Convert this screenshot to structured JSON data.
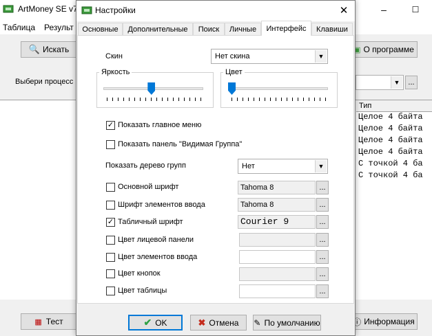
{
  "main_window": {
    "title": "ArtMoney SE v7",
    "menu": [
      "Таблица",
      "Результ"
    ],
    "search_button": "Искать",
    "about_button": "О программе",
    "process_label": "Выбери процесс",
    "test_button": "Тест",
    "info_button": "Информация",
    "table": {
      "header": "Тип",
      "rows": [
        "Целое 4 байта",
        "Целое 4 байта",
        "Целое 4 байта",
        "Целое 4 байта",
        "С точкой 4 ба",
        "С точкой 4 ба"
      ]
    }
  },
  "dialog": {
    "title": "Настройки",
    "tabs": [
      "Основные",
      "Дополнительные",
      "Поиск",
      "Личные",
      "Интерфейс",
      "Клавиши"
    ],
    "active_tab": "Интерфейс",
    "skin": {
      "label": "Скин",
      "value": "Нет скина"
    },
    "brightness": {
      "label": "Яркость",
      "level": 0.48
    },
    "color": {
      "label": "Цвет",
      "level": 0.0
    },
    "checkboxes": {
      "show_main_menu": {
        "label": "Показать главное меню",
        "checked": true
      },
      "show_visible_group": {
        "label": "Показать панель \"Видимая Группа\"",
        "checked": false
      }
    },
    "group_tree": {
      "label": "Показать дерево групп",
      "value": "Нет"
    },
    "font_options": [
      {
        "label": "Основной шрифт",
        "checked": false,
        "value": "Tahoma 8"
      },
      {
        "label": "Шрифт элементов ввода",
        "checked": false,
        "value": "Tahoma 8"
      },
      {
        "label": "Табличный шрифт",
        "checked": true,
        "value": "Courier 9"
      },
      {
        "label": "Цвет лицевой панели",
        "checked": false,
        "value": ""
      },
      {
        "label": "Цвет элементов ввода",
        "checked": false,
        "value": ""
      },
      {
        "label": "Цвет кнопок",
        "checked": false,
        "value": ""
      },
      {
        "label": "Цвет таблицы",
        "checked": false,
        "value": ""
      }
    ],
    "browse_label": "...",
    "buttons": {
      "ok": "OK",
      "cancel": "Отмена",
      "default": "По умолчанию"
    }
  },
  "colors": {
    "accent": "#0078d7",
    "ok_check": "#2ea043",
    "cancel_x": "#c42b1c"
  }
}
